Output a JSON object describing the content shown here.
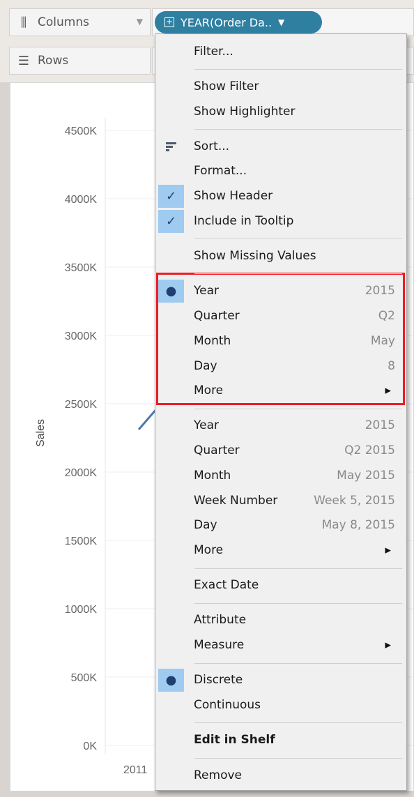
{
  "shelf": {
    "columns_label": "Columns",
    "rows_label": "Rows",
    "pill_label": "YEAR(Order Da.."
  },
  "chart": {
    "ylabel": "Sales",
    "x_first_tick": "2011"
  },
  "chart_data": {
    "type": "line",
    "title": "",
    "xlabel": "",
    "ylabel": "Sales",
    "yticks": [
      "4500K",
      "4000K",
      "3500K",
      "3000K",
      "2500K",
      "2000K",
      "1500K",
      "1000K",
      "500K",
      "0K"
    ],
    "ylim": [
      0,
      4500000
    ],
    "categories": [
      "2011"
    ],
    "series": [
      {
        "values": [
          2260000
        ]
      }
    ],
    "grid": true
  },
  "menu": {
    "items": [
      {
        "label": "Filter..."
      },
      {
        "label": "Show Filter"
      },
      {
        "label": "Show Highlighter"
      },
      {
        "label": "Sort...",
        "icon": "sort-icon"
      },
      {
        "label": "Format..."
      },
      {
        "label": "Show Header",
        "mark": "✓",
        "icon": "checkmark-icon"
      },
      {
        "label": "Include in Tooltip",
        "mark": "✓",
        "icon": "checkmark-icon"
      },
      {
        "label": "Show Missing Values"
      },
      {
        "label": "Year",
        "value": "2015",
        "mark": "●",
        "icon": "radio-bullet-icon"
      },
      {
        "label": "Quarter",
        "value": "Q2"
      },
      {
        "label": "Month",
        "value": "May"
      },
      {
        "label": "Day",
        "value": "8"
      },
      {
        "label": "More",
        "arrow": "▶",
        "icon": "submenu-arrow-icon"
      },
      {
        "label": "Year",
        "value": "2015"
      },
      {
        "label": "Quarter",
        "value": "Q2 2015"
      },
      {
        "label": "Month",
        "value": "May 2015"
      },
      {
        "label": "Week Number",
        "value": "Week 5, 2015"
      },
      {
        "label": "Day",
        "value": "May 8, 2015"
      },
      {
        "label": "More",
        "arrow": "▶",
        "icon": "submenu-arrow-icon"
      },
      {
        "label": "Exact Date"
      },
      {
        "label": "Attribute"
      },
      {
        "label": "Measure",
        "arrow": "▶",
        "icon": "submenu-arrow-icon"
      },
      {
        "label": "Discrete",
        "mark": "●",
        "icon": "radio-bullet-icon"
      },
      {
        "label": "Continuous"
      },
      {
        "label": "Edit in Shelf"
      },
      {
        "label": "Remove"
      }
    ]
  },
  "colors": {
    "pill": "#2f7fa1",
    "selection": "#9fcbf0",
    "highlight_box": "#ee1c24",
    "line": "#4e79a7"
  }
}
